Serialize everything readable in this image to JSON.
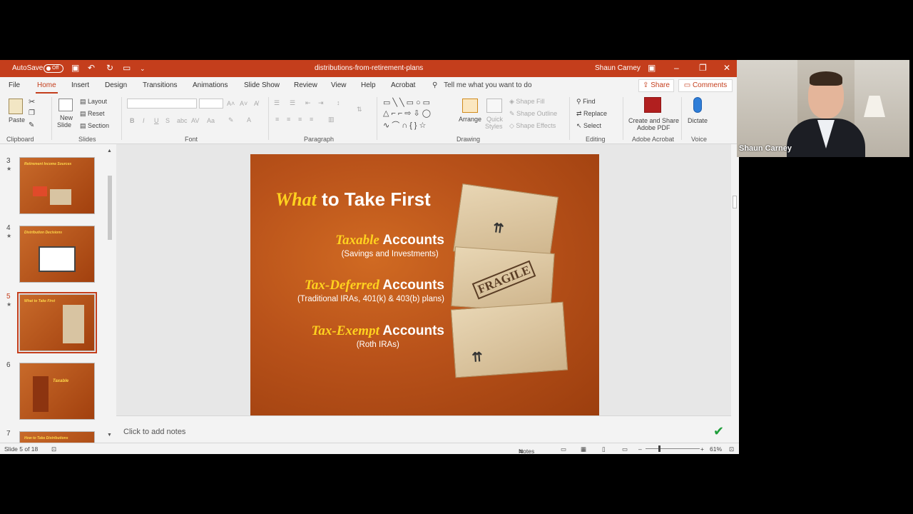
{
  "titlebar": {
    "autosave_label": "AutoSave",
    "autosave_state": "Off",
    "doc_title": "distributions-from-retirement-plans",
    "user_name": "Shaun Carney"
  },
  "tabs": [
    "File",
    "Home",
    "Insert",
    "Design",
    "Transitions",
    "Animations",
    "Slide Show",
    "Review",
    "View",
    "Help",
    "Acrobat"
  ],
  "active_tab": "Home",
  "search_placeholder": "Tell me what you want to do",
  "share_label": "Share",
  "comments_label": "Comments",
  "ribbon": {
    "clipboard": {
      "paste": "Paste",
      "label": "Clipboard"
    },
    "slides": {
      "new_slide": "New",
      "new_slide2": "Slide",
      "layout": "Layout",
      "reset": "Reset",
      "section": "Section",
      "label": "Slides"
    },
    "font": {
      "label": "Font"
    },
    "paragraph": {
      "label": "Paragraph"
    },
    "drawing": {
      "arrange": "Arrange",
      "quick_styles": "Quick",
      "quick_styles2": "Styles",
      "shape_fill": "Shape Fill",
      "shape_outline": "Shape Outline",
      "shape_effects": "Shape Effects",
      "label": "Drawing"
    },
    "editing": {
      "find": "Find",
      "replace": "Replace",
      "select": "Select",
      "label": "Editing"
    },
    "acrobat": {
      "create_share": "Create and Share",
      "adobe_pdf": "Adobe PDF",
      "label": "Adobe Acrobat"
    },
    "voice": {
      "dictate": "Dictate",
      "label": "Voice"
    }
  },
  "thumbnails": [
    {
      "num": "3",
      "title": "Retirement Income Sources",
      "selected": false
    },
    {
      "num": "4",
      "title": "Distribution Decisions",
      "selected": false
    },
    {
      "num": "5",
      "title": "What to Take First",
      "selected": true
    },
    {
      "num": "6",
      "title": "Taxable",
      "selected": false
    },
    {
      "num": "7",
      "title": "How to Take Distributions",
      "selected": false
    }
  ],
  "slide": {
    "title_em": "What",
    "title_rest": " to Take First",
    "accounts": [
      {
        "em": "Taxable",
        "rest": " Accounts",
        "sub": "(Savings and Investments)"
      },
      {
        "em": "Tax-Deferred",
        "rest": " Accounts",
        "sub": "(Traditional IRAs, 401(k) & 403(b) plans)"
      },
      {
        "em": "Tax-Exempt",
        "rest": " Accounts",
        "sub": "(Roth IRAs)"
      }
    ],
    "box_label": "FRAGILE"
  },
  "notes_placeholder": "Click to add notes",
  "status": {
    "slide_info": "Slide 5 of 18",
    "notes": "Notes",
    "zoom": "61%"
  },
  "webcam": {
    "name": "Shaun Carney"
  }
}
